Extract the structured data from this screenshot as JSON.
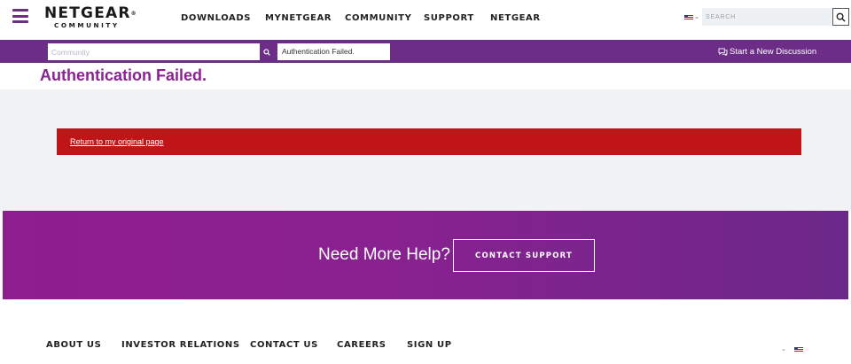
{
  "header": {
    "logo_text": "NETGEAR",
    "logo_mark": "®",
    "logo_sub": "COMMUNITY",
    "nav": [
      "DOWNLOADS",
      "MYNETGEAR",
      "COMMUNITY",
      "SUPPORT",
      "NETGEAR"
    ],
    "search_placeholder": "SEARCH",
    "icons": [
      "hamburger-menu-icon",
      "us-flag-icon",
      "chevron-down-icon",
      "search-icon"
    ]
  },
  "community_bar": {
    "search_placeholder": "Community",
    "breadcrumb": "Authentication Failed.",
    "new_discussion_label": "Start a New Discussion",
    "icons": [
      "search-icon",
      "discussion-icon"
    ]
  },
  "page": {
    "title": "Authentication Failed."
  },
  "alert": {
    "link_text": "Return to my original page"
  },
  "help": {
    "text": "Need More Help?",
    "button_label": "CONTACT SUPPORT"
  },
  "footer": {
    "links": [
      "ABOUT US",
      "INVESTOR RELATIONS",
      "CONTACT US",
      "CAREERS",
      "SIGN UP"
    ]
  },
  "colors": {
    "brand_purple": "#6b2d86",
    "title_purple": "#8a2391",
    "alert_red": "#c01518",
    "gray_background": "#f0f2f3"
  }
}
